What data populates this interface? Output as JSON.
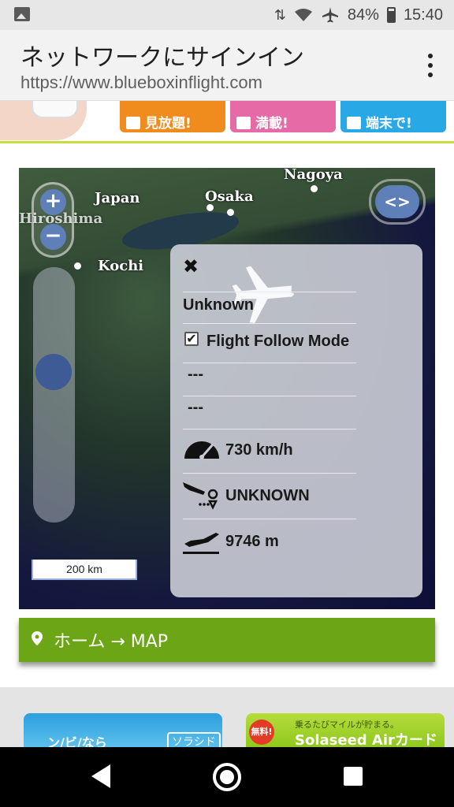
{
  "status": {
    "battery": "84%",
    "time": "15:40",
    "icons": [
      "image-icon",
      "signal-icon",
      "wifi-icon",
      "airplane-icon",
      "battery-icon"
    ]
  },
  "browser": {
    "title": "ネットワークにサインイン",
    "url": "https://www.blueboxinflight.com"
  },
  "ad_band": {
    "buttons": [
      {
        "label": "見放題!",
        "color": "#f08c1e"
      },
      {
        "label": "満載!",
        "color": "#e66aa6"
      },
      {
        "label": "端末で!",
        "color": "#29a8e6"
      }
    ]
  },
  "map": {
    "cities": [
      {
        "name": "Nagoya"
      },
      {
        "name": "Japan"
      },
      {
        "name": "Osaka"
      },
      {
        "name": "Hiroshima"
      },
      {
        "name": "Kochi"
      }
    ],
    "zoom_in": "+",
    "zoom_out": "−",
    "expand": "<>",
    "scale": "200 km"
  },
  "flight_panel": {
    "close": "✖",
    "name": "Unknown",
    "follow_mode_label": "Flight Follow Mode",
    "follow_mode_checked": true,
    "line1": "---",
    "line2": "---",
    "speed": "730 km/h",
    "destination": "UNKNOWN",
    "altitude": "9746 m"
  },
  "breadcrumb": {
    "text": "ホーム → MAP"
  },
  "banners": {
    "left_text": "ン/ビ/なら",
    "left_box": "ソラシド+",
    "right_badge": "無料!",
    "right_small": "乗るたびマイルが貯まる。",
    "right_big": "Solaseed Airカード"
  }
}
